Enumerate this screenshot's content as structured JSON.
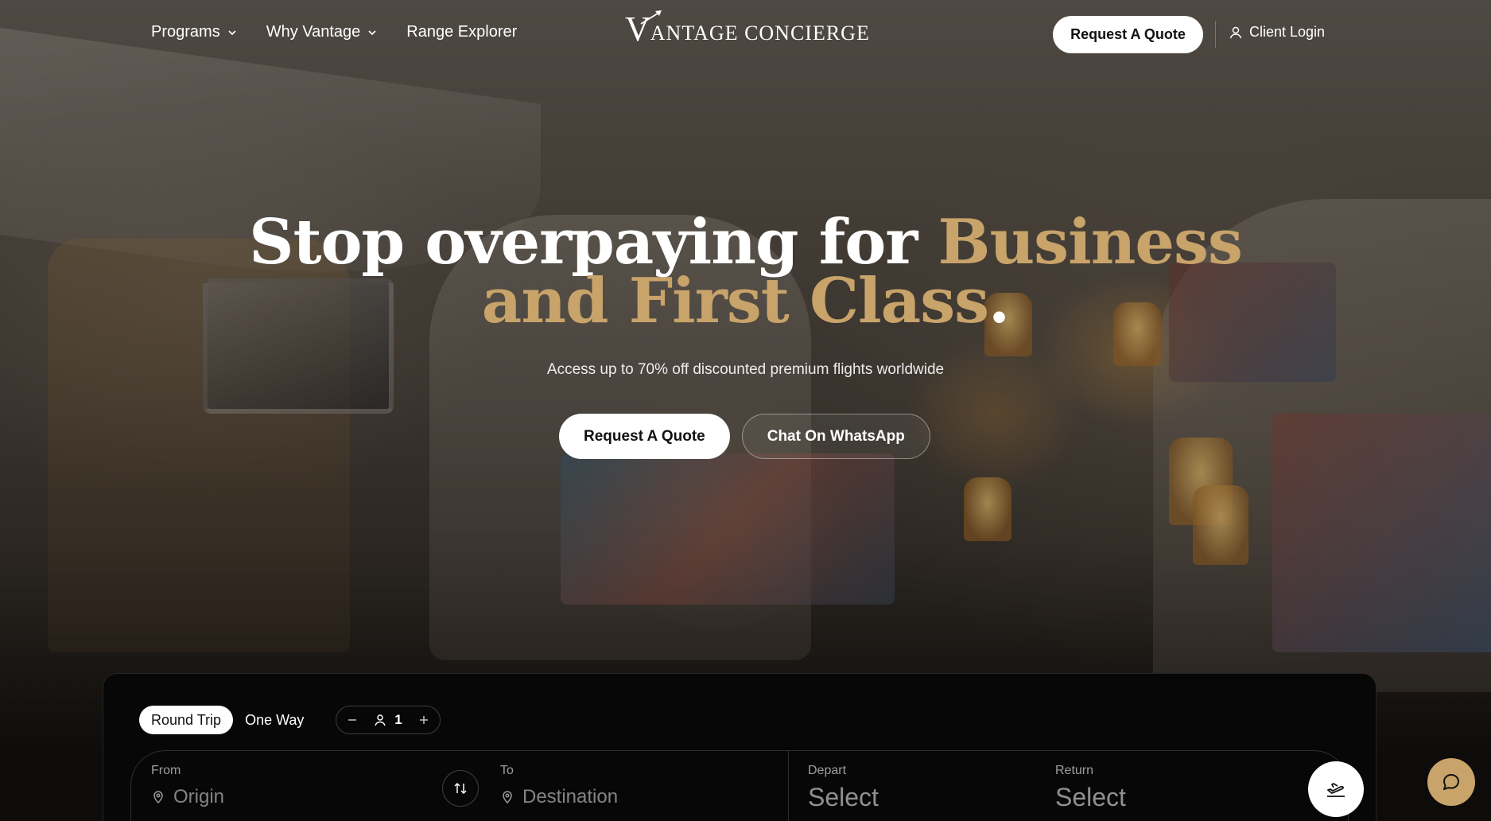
{
  "nav": {
    "items": [
      {
        "label": "Programs",
        "has_dropdown": true
      },
      {
        "label": "Why Vantage",
        "has_dropdown": true
      },
      {
        "label": "Range Explorer",
        "has_dropdown": false
      }
    ],
    "logo": {
      "letter": "V",
      "text": "ANTAGE CONCIERGE"
    },
    "quote_label": "Request A Quote",
    "login_label": "Client Login"
  },
  "hero": {
    "title_plain": "Stop overpaying for ",
    "title_gold": "Business and First Class",
    "title_end": ".",
    "subtitle": "Access up to 70% off discounted premium flights worldwide",
    "primary_cta": "Request A Quote",
    "secondary_cta": "Chat On WhatsApp"
  },
  "search": {
    "trip_types": [
      "Round Trip",
      "One Way"
    ],
    "active_trip_type": "Round Trip",
    "passengers": "1",
    "from": {
      "label": "From",
      "placeholder": "Origin"
    },
    "to": {
      "label": "To",
      "placeholder": "Destination"
    },
    "depart": {
      "label": "Depart",
      "placeholder": "Select"
    },
    "return": {
      "label": "Return",
      "placeholder": "Select"
    }
  },
  "colors": {
    "accent_gold": "#c8a36a",
    "card_bg": "#070707"
  },
  "icons": {
    "nav_dropdown": "chevron-down-icon",
    "login": "user-icon",
    "passenger": "user-icon",
    "swap": "swap-vertical-icon",
    "location": "map-pin-icon",
    "search_submit": "plane-departure-icon",
    "chat": "chat-bubble-icon"
  }
}
